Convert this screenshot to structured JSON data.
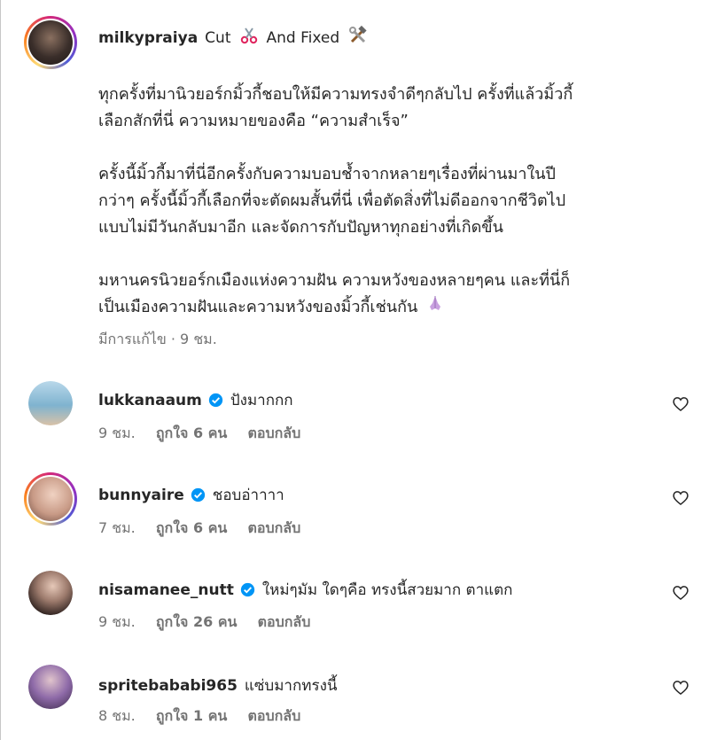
{
  "post": {
    "username": "milkypraiya",
    "caption_head": "Cut",
    "caption_mid": "And Fixed",
    "scissors_icon": "scissors-icon",
    "tools_icon": "hammer-wrench-icon",
    "paragraphs": [
      "ทุกครั้งที่มานิวยอร์กมิ้วกี้ชอบให้มีความทรงจำดีๆกลับไป ครั้งที่แล้วมิ้วกี้\nเลือกสักที่นี่ ความหมายของคือ “ความสำเร็จ”",
      "ครั้งนี้มิ้วกี้มาที่นี่อีกครั้งกับความบอบช้ำจากหลายๆเรื่องที่ผ่านมาในปี\nกว่าๆ ครั้งนี้มิ้วกี้เลือกที่จะตัดผมสั้นที่นี่ เพื่อตัดสิ่งที่ไม่ดีออกจากชีวิตไป\nแบบไม่มีวันกลับมาอีก และจัดการกับปัญหาทุกอย่างที่เกิดขึ้น",
      "มหานครนิวยอร์กเมืองแห่งความฝัน ความหวังของหลายๆคน และที่นี่ก็\nเป็นเมืองความฝันและความหวังของมิ้วกี้เช่นกัน"
    ],
    "pray_icon": "praying-hands-icon",
    "edited_label": "มีการแก้ไข · 9 ชม."
  },
  "comments": [
    {
      "username": "lukkanaaum",
      "verified": true,
      "text": "ปังมากกก",
      "time": "9 ชม.",
      "likes": "ถูกใจ 6 คน",
      "reply": "ตอบกลับ",
      "avatar_color": "#6fa9c9",
      "ring": false
    },
    {
      "username": "bunnyaire",
      "verified": true,
      "text": "ชอบอ่าาาา",
      "time": "7 ชม.",
      "likes": "ถูกใจ 6 คน",
      "reply": "ตอบกลับ",
      "avatar_color": "#d8b0a0",
      "ring": true
    },
    {
      "username": "nisamanee_nutt",
      "verified": true,
      "text": "ใหม่ๆมัม ใดๆคือ ทรงนี้สวยมาก ตาแตก",
      "time": "9 ชม.",
      "likes": "ถูกใจ 26 คน",
      "reply": "ตอบกลับ",
      "avatar_color": "#3a2a2a",
      "ring": false
    },
    {
      "username": "spritebababi965",
      "verified": false,
      "text": "แซ่บมากทรงนี้",
      "time": "8 ชม.",
      "likes": "ถูกใจ 1 คน",
      "reply": "ตอบกลับ",
      "avatar_color": "#7a5a9a",
      "ring": false
    }
  ],
  "colors": {
    "verified_blue": "#0095f6",
    "muted": "#737373",
    "text": "#262626"
  }
}
